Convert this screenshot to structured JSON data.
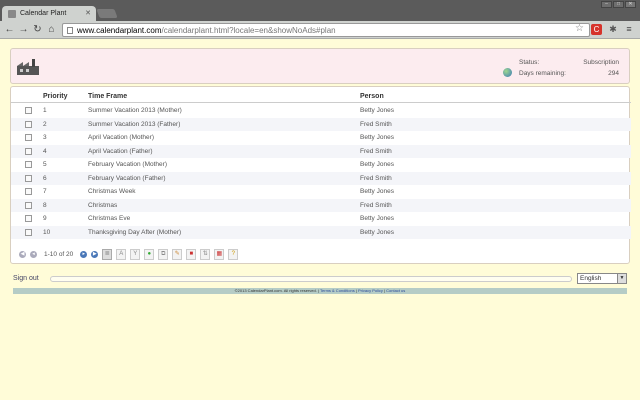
{
  "browser": {
    "tab_title": "Calendar Plant",
    "url_host": "www.calendarplant.com",
    "url_path": "/calendarplant.html?locale=en&showNoAds#plan",
    "ext_red_label": "C"
  },
  "header": {
    "status_label": "Status:",
    "status_value": "Subscription",
    "days_label": "Days remaining:",
    "days_value": "294"
  },
  "table": {
    "columns": [
      "Priority",
      "Time Frame",
      "Person"
    ],
    "rows": [
      {
        "priority": "1",
        "time_frame": "Summer Vacation 2013 (Mother)",
        "person": "Betty Jones"
      },
      {
        "priority": "2",
        "time_frame": "Summer Vacation 2013 (Father)",
        "person": "Fred Smith"
      },
      {
        "priority": "3",
        "time_frame": "April Vacation (Mother)",
        "person": "Betty Jones"
      },
      {
        "priority": "4",
        "time_frame": "April Vacation (Father)",
        "person": "Fred Smith"
      },
      {
        "priority": "5",
        "time_frame": "February Vacation (Mother)",
        "person": "Betty Jones"
      },
      {
        "priority": "6",
        "time_frame": "February Vacation (Father)",
        "person": "Fred Smith"
      },
      {
        "priority": "7",
        "time_frame": "Christmas Week",
        "person": "Betty Jones"
      },
      {
        "priority": "8",
        "time_frame": "Christmas",
        "person": "Fred Smith"
      },
      {
        "priority": "9",
        "time_frame": "Christmas Eve",
        "person": "Betty Jones"
      },
      {
        "priority": "10",
        "time_frame": "Thanksgiving Day After (Mother)",
        "person": "Betty Jones"
      }
    ]
  },
  "pager": {
    "range_label": "1-10 of 20"
  },
  "footer": {
    "sign_out": "Sign out",
    "language": "English",
    "copyright": "©2013 CalendarPlant.com. All rights reserved.",
    "terms": "Terms & Conditions",
    "privacy": "Privacy Policy",
    "contact": "Contact us"
  },
  "colors": {
    "page_bg": "#fffcd8",
    "header_bg": "#fcecef",
    "footer_bar": "#b5ccc6"
  }
}
